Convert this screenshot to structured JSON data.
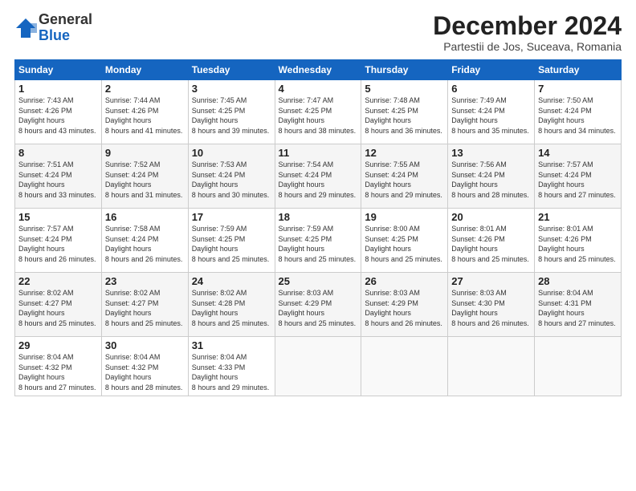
{
  "logo": {
    "general": "General",
    "blue": "Blue"
  },
  "title": "December 2024",
  "location": "Partestii de Jos, Suceava, Romania",
  "headers": [
    "Sunday",
    "Monday",
    "Tuesday",
    "Wednesday",
    "Thursday",
    "Friday",
    "Saturday"
  ],
  "weeks": [
    [
      {
        "day": "1",
        "sunrise": "7:43 AM",
        "sunset": "4:26 PM",
        "daylight": "8 hours and 43 minutes."
      },
      {
        "day": "2",
        "sunrise": "7:44 AM",
        "sunset": "4:26 PM",
        "daylight": "8 hours and 41 minutes."
      },
      {
        "day": "3",
        "sunrise": "7:45 AM",
        "sunset": "4:25 PM",
        "daylight": "8 hours and 39 minutes."
      },
      {
        "day": "4",
        "sunrise": "7:47 AM",
        "sunset": "4:25 PM",
        "daylight": "8 hours and 38 minutes."
      },
      {
        "day": "5",
        "sunrise": "7:48 AM",
        "sunset": "4:25 PM",
        "daylight": "8 hours and 36 minutes."
      },
      {
        "day": "6",
        "sunrise": "7:49 AM",
        "sunset": "4:24 PM",
        "daylight": "8 hours and 35 minutes."
      },
      {
        "day": "7",
        "sunrise": "7:50 AM",
        "sunset": "4:24 PM",
        "daylight": "8 hours and 34 minutes."
      }
    ],
    [
      {
        "day": "8",
        "sunrise": "7:51 AM",
        "sunset": "4:24 PM",
        "daylight": "8 hours and 33 minutes."
      },
      {
        "day": "9",
        "sunrise": "7:52 AM",
        "sunset": "4:24 PM",
        "daylight": "8 hours and 31 minutes."
      },
      {
        "day": "10",
        "sunrise": "7:53 AM",
        "sunset": "4:24 PM",
        "daylight": "8 hours and 30 minutes."
      },
      {
        "day": "11",
        "sunrise": "7:54 AM",
        "sunset": "4:24 PM",
        "daylight": "8 hours and 29 minutes."
      },
      {
        "day": "12",
        "sunrise": "7:55 AM",
        "sunset": "4:24 PM",
        "daylight": "8 hours and 29 minutes."
      },
      {
        "day": "13",
        "sunrise": "7:56 AM",
        "sunset": "4:24 PM",
        "daylight": "8 hours and 28 minutes."
      },
      {
        "day": "14",
        "sunrise": "7:57 AM",
        "sunset": "4:24 PM",
        "daylight": "8 hours and 27 minutes."
      }
    ],
    [
      {
        "day": "15",
        "sunrise": "7:57 AM",
        "sunset": "4:24 PM",
        "daylight": "8 hours and 26 minutes."
      },
      {
        "day": "16",
        "sunrise": "7:58 AM",
        "sunset": "4:24 PM",
        "daylight": "8 hours and 26 minutes."
      },
      {
        "day": "17",
        "sunrise": "7:59 AM",
        "sunset": "4:25 PM",
        "daylight": "8 hours and 25 minutes."
      },
      {
        "day": "18",
        "sunrise": "7:59 AM",
        "sunset": "4:25 PM",
        "daylight": "8 hours and 25 minutes."
      },
      {
        "day": "19",
        "sunrise": "8:00 AM",
        "sunset": "4:25 PM",
        "daylight": "8 hours and 25 minutes."
      },
      {
        "day": "20",
        "sunrise": "8:01 AM",
        "sunset": "4:26 PM",
        "daylight": "8 hours and 25 minutes."
      },
      {
        "day": "21",
        "sunrise": "8:01 AM",
        "sunset": "4:26 PM",
        "daylight": "8 hours and 25 minutes."
      }
    ],
    [
      {
        "day": "22",
        "sunrise": "8:02 AM",
        "sunset": "4:27 PM",
        "daylight": "8 hours and 25 minutes."
      },
      {
        "day": "23",
        "sunrise": "8:02 AM",
        "sunset": "4:27 PM",
        "daylight": "8 hours and 25 minutes."
      },
      {
        "day": "24",
        "sunrise": "8:02 AM",
        "sunset": "4:28 PM",
        "daylight": "8 hours and 25 minutes."
      },
      {
        "day": "25",
        "sunrise": "8:03 AM",
        "sunset": "4:29 PM",
        "daylight": "8 hours and 25 minutes."
      },
      {
        "day": "26",
        "sunrise": "8:03 AM",
        "sunset": "4:29 PM",
        "daylight": "8 hours and 26 minutes."
      },
      {
        "day": "27",
        "sunrise": "8:03 AM",
        "sunset": "4:30 PM",
        "daylight": "8 hours and 26 minutes."
      },
      {
        "day": "28",
        "sunrise": "8:04 AM",
        "sunset": "4:31 PM",
        "daylight": "8 hours and 27 minutes."
      }
    ],
    [
      {
        "day": "29",
        "sunrise": "8:04 AM",
        "sunset": "4:32 PM",
        "daylight": "8 hours and 27 minutes."
      },
      {
        "day": "30",
        "sunrise": "8:04 AM",
        "sunset": "4:32 PM",
        "daylight": "8 hours and 28 minutes."
      },
      {
        "day": "31",
        "sunrise": "8:04 AM",
        "sunset": "4:33 PM",
        "daylight": "8 hours and 29 minutes."
      },
      null,
      null,
      null,
      null
    ]
  ]
}
